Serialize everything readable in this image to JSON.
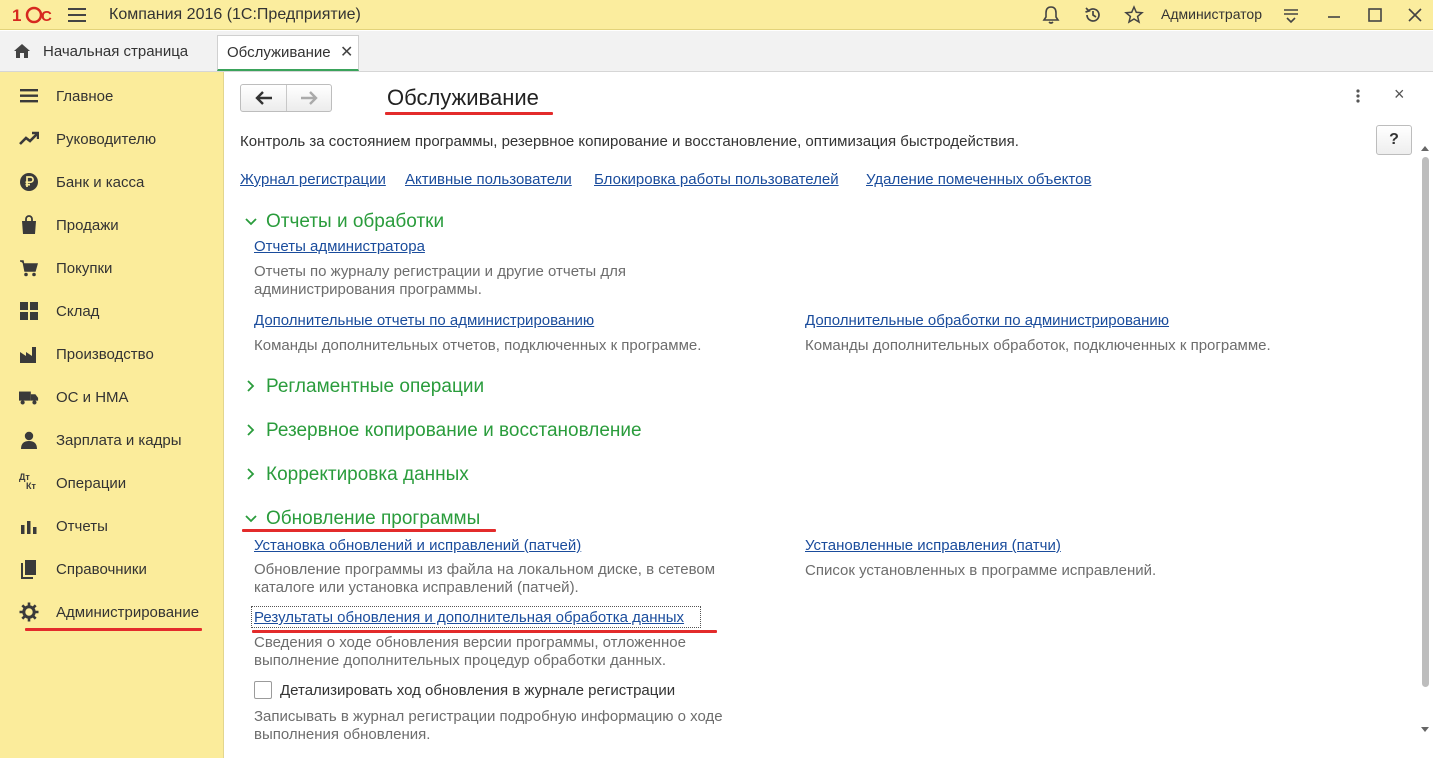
{
  "titlebar": {
    "app_title": "Компания 2016  (1С:Предприятие)",
    "user": "Администратор"
  },
  "tabs": {
    "home_label": "Начальная страница",
    "active_label": "Обслуживание",
    "close_glyph": "✕"
  },
  "sidebar": {
    "items": [
      {
        "label": "Главное",
        "icon": "menu-lines-icon"
      },
      {
        "label": "Руководителю",
        "icon": "trend-up-icon"
      },
      {
        "label": "Банк и касса",
        "icon": "ruble-coin-icon"
      },
      {
        "label": "Продажи",
        "icon": "shopping-bag-icon"
      },
      {
        "label": "Покупки",
        "icon": "cart-icon"
      },
      {
        "label": "Склад",
        "icon": "warehouse-grid-icon"
      },
      {
        "label": "Производство",
        "icon": "factory-icon"
      },
      {
        "label": "ОС и НМА",
        "icon": "truck-icon"
      },
      {
        "label": "Зарплата и кадры",
        "icon": "person-icon"
      },
      {
        "label": "Операции",
        "icon": "dt-kt-icon"
      },
      {
        "label": "Отчеты",
        "icon": "bar-chart-icon"
      },
      {
        "label": "Справочники",
        "icon": "books-icon"
      },
      {
        "label": "Администрирование",
        "icon": "gear-icon"
      }
    ],
    "dt_text": "Дт",
    "kt_text": "Кт"
  },
  "content": {
    "title": "Обслуживание",
    "description": "Контроль за состоянием программы, резервное копирование и восстановление, оптимизация быстродействия.",
    "help_label": "?",
    "close_glyph": "×",
    "top_links": [
      "Журнал регистрации",
      "Активные пользователи",
      "Блокировка работы пользователей",
      "Удаление помеченных объектов"
    ],
    "sections": {
      "reports": {
        "title": "Отчеты и обработки",
        "admin_reports_link": "Отчеты администратора",
        "admin_reports_note": "Отчеты по журналу регистрации и другие отчеты для администрирования программы.",
        "extra_reports_link": "Дополнительные отчеты по администрированию",
        "extra_reports_note": "Команды дополнительных отчетов, подключенных к программе.",
        "extra_processing_link": "Дополнительные обработки по администрированию",
        "extra_processing_note": "Команды дополнительных обработок, подключенных к программе."
      },
      "regulated": {
        "title": "Регламентные операции"
      },
      "backup": {
        "title": "Резервное копирование и восстановление"
      },
      "correction": {
        "title": "Корректировка данных"
      },
      "update": {
        "title": "Обновление программы",
        "install_link": "Установка обновлений и исправлений (патчей)",
        "install_note": "Обновление программы из файла на локальном диске, в сетевом каталоге или установка исправлений (патчей).",
        "installed_link": "Установленные исправления (патчи)",
        "installed_note": "Список установленных в программе исправлений.",
        "results_link": "Результаты обновления и дополнительная обработка данных",
        "results_note": "Сведения о ходе обновления версии программы, отложенное выполнение дополнительных процедур обработки данных.",
        "detail_checkbox_label": "Детализировать ход обновления в журнале регистрации",
        "detail_checkbox_checked": false,
        "detail_note": "Записывать в журнал регистрации подробную информацию о ходе выполнения обновления."
      }
    }
  },
  "colors": {
    "sidebar_bg": "#FBEC9B",
    "section_green": "#2a9c3c",
    "link_blue": "#1a4c9c",
    "annotation_red": "#e32b2b"
  }
}
